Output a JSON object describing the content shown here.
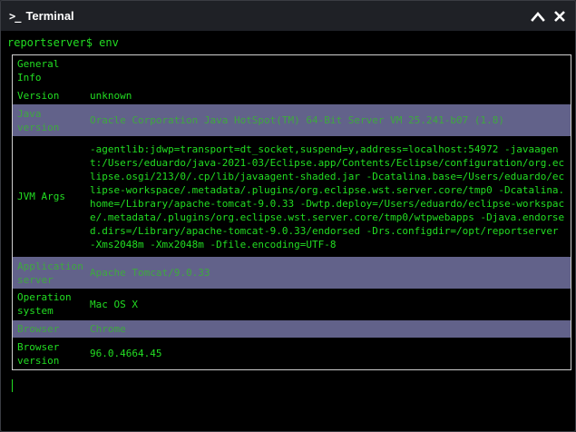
{
  "window": {
    "title": "Terminal",
    "prompt_icon": ">_"
  },
  "terminal": {
    "prompt": "reportserver$ env",
    "rows": [
      {
        "key": "General Info",
        "value": "",
        "highlight": false
      },
      {
        "key": "Version",
        "value": "unknown",
        "highlight": false
      },
      {
        "key": "Java version",
        "value": "Oracle Corporation Java HotSpot(TM) 64-Bit Server VM 25.241-b07 (1.8)",
        "highlight": true
      },
      {
        "key": "JVM Args",
        "value": "-agentlib:jdwp=transport=dt_socket,suspend=y,address=localhost:54972 -javaagent:/Users/eduardo/java-2021-03/Eclipse.app/Contents/Eclipse/configuration/org.eclipse.osgi/213/0/.cp/lib/javaagent-shaded.jar -Dcatalina.base=/Users/eduardo/eclipse-workspace/.metadata/.plugins/org.eclipse.wst.server.core/tmp0 -Dcatalina.home=/Library/apache-tomcat-9.0.33 -Dwtp.deploy=/Users/eduardo/eclipse-workspace/.metadata/.plugins/org.eclipse.wst.server.core/tmp0/wtpwebapps -Djava.endorsed.dirs=/Library/apache-tomcat-9.0.33/endorsed -Drs.configdir=/opt/reportserver -Xms2048m -Xmx2048m -Dfile.encoding=UTF-8",
        "highlight": false
      },
      {
        "key": "Application server",
        "value": "Apache Tomcat/9.0.33",
        "highlight": true
      },
      {
        "key": "Operation system",
        "value": "Mac OS X",
        "highlight": false
      },
      {
        "key": "Browser",
        "value": "Chrome",
        "highlight": true
      },
      {
        "key": "Browser version",
        "value": "96.0.4664.45",
        "highlight": false
      }
    ]
  },
  "colors": {
    "terminal_text": "#22dd22",
    "row_highlight": "#62628a",
    "titlebar": "#1f2126",
    "background": "#000000"
  }
}
